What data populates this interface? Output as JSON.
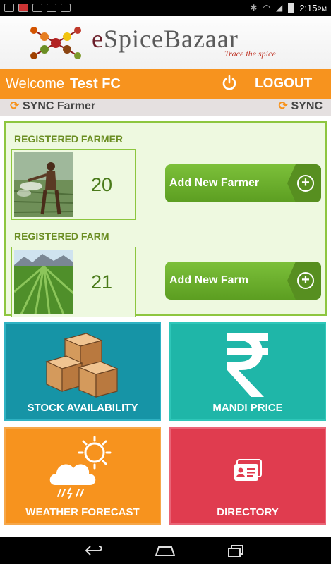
{
  "status_bar": {
    "time": "2:15",
    "ampm": "PM"
  },
  "header": {
    "brand": "SpiceBazaar",
    "brand_prefix": "e",
    "tagline": "Trace the spice"
  },
  "welcome_bar": {
    "greeting": "Welcome",
    "user_name": "Test FC",
    "logout_label": "LOGOUT"
  },
  "sync_bar": {
    "left_label": "SYNC Farmer",
    "right_label": "SYNC"
  },
  "registered": {
    "farmer_title": "REGISTERED FARMER",
    "farmer_count": "20",
    "add_farmer_label": "Add New Farmer",
    "farm_title": "REGISTERED FARM",
    "farm_count": "21",
    "add_farm_label": "Add New Farm"
  },
  "tiles": {
    "stock": {
      "label": "STOCK AVAILABILITY",
      "icon": "boxes-icon"
    },
    "mandi": {
      "label": "MANDI PRICE",
      "icon": "rupee-icon"
    },
    "weather": {
      "label": "WEATHER FORECAST",
      "icon": "weather-icon"
    },
    "directory": {
      "label": "DIRECTORY",
      "icon": "contact-card-icon"
    }
  },
  "colors": {
    "orange": "#f7931e",
    "green": "#8dc63f",
    "teal_dark": "#1694a6",
    "teal": "#1fb6a8",
    "red": "#e03c4f"
  }
}
